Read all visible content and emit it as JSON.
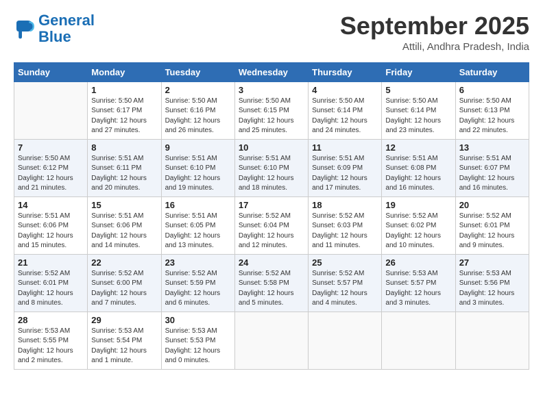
{
  "header": {
    "logo_line1": "General",
    "logo_line2": "Blue",
    "month_title": "September 2025",
    "location": "Attili, Andhra Pradesh, India"
  },
  "columns": [
    "Sunday",
    "Monday",
    "Tuesday",
    "Wednesday",
    "Thursday",
    "Friday",
    "Saturday"
  ],
  "weeks": [
    [
      {
        "day": "",
        "info": ""
      },
      {
        "day": "1",
        "info": "Sunrise: 5:50 AM\nSunset: 6:17 PM\nDaylight: 12 hours\nand 27 minutes."
      },
      {
        "day": "2",
        "info": "Sunrise: 5:50 AM\nSunset: 6:16 PM\nDaylight: 12 hours\nand 26 minutes."
      },
      {
        "day": "3",
        "info": "Sunrise: 5:50 AM\nSunset: 6:15 PM\nDaylight: 12 hours\nand 25 minutes."
      },
      {
        "day": "4",
        "info": "Sunrise: 5:50 AM\nSunset: 6:14 PM\nDaylight: 12 hours\nand 24 minutes."
      },
      {
        "day": "5",
        "info": "Sunrise: 5:50 AM\nSunset: 6:14 PM\nDaylight: 12 hours\nand 23 minutes."
      },
      {
        "day": "6",
        "info": "Sunrise: 5:50 AM\nSunset: 6:13 PM\nDaylight: 12 hours\nand 22 minutes."
      }
    ],
    [
      {
        "day": "7",
        "info": "Sunrise: 5:50 AM\nSunset: 6:12 PM\nDaylight: 12 hours\nand 21 minutes."
      },
      {
        "day": "8",
        "info": "Sunrise: 5:51 AM\nSunset: 6:11 PM\nDaylight: 12 hours\nand 20 minutes."
      },
      {
        "day": "9",
        "info": "Sunrise: 5:51 AM\nSunset: 6:10 PM\nDaylight: 12 hours\nand 19 minutes."
      },
      {
        "day": "10",
        "info": "Sunrise: 5:51 AM\nSunset: 6:10 PM\nDaylight: 12 hours\nand 18 minutes."
      },
      {
        "day": "11",
        "info": "Sunrise: 5:51 AM\nSunset: 6:09 PM\nDaylight: 12 hours\nand 17 minutes."
      },
      {
        "day": "12",
        "info": "Sunrise: 5:51 AM\nSunset: 6:08 PM\nDaylight: 12 hours\nand 16 minutes."
      },
      {
        "day": "13",
        "info": "Sunrise: 5:51 AM\nSunset: 6:07 PM\nDaylight: 12 hours\nand 16 minutes."
      }
    ],
    [
      {
        "day": "14",
        "info": "Sunrise: 5:51 AM\nSunset: 6:06 PM\nDaylight: 12 hours\nand 15 minutes."
      },
      {
        "day": "15",
        "info": "Sunrise: 5:51 AM\nSunset: 6:06 PM\nDaylight: 12 hours\nand 14 minutes."
      },
      {
        "day": "16",
        "info": "Sunrise: 5:51 AM\nSunset: 6:05 PM\nDaylight: 12 hours\nand 13 minutes."
      },
      {
        "day": "17",
        "info": "Sunrise: 5:52 AM\nSunset: 6:04 PM\nDaylight: 12 hours\nand 12 minutes."
      },
      {
        "day": "18",
        "info": "Sunrise: 5:52 AM\nSunset: 6:03 PM\nDaylight: 12 hours\nand 11 minutes."
      },
      {
        "day": "19",
        "info": "Sunrise: 5:52 AM\nSunset: 6:02 PM\nDaylight: 12 hours\nand 10 minutes."
      },
      {
        "day": "20",
        "info": "Sunrise: 5:52 AM\nSunset: 6:01 PM\nDaylight: 12 hours\nand 9 minutes."
      }
    ],
    [
      {
        "day": "21",
        "info": "Sunrise: 5:52 AM\nSunset: 6:01 PM\nDaylight: 12 hours\nand 8 minutes."
      },
      {
        "day": "22",
        "info": "Sunrise: 5:52 AM\nSunset: 6:00 PM\nDaylight: 12 hours\nand 7 minutes."
      },
      {
        "day": "23",
        "info": "Sunrise: 5:52 AM\nSunset: 5:59 PM\nDaylight: 12 hours\nand 6 minutes."
      },
      {
        "day": "24",
        "info": "Sunrise: 5:52 AM\nSunset: 5:58 PM\nDaylight: 12 hours\nand 5 minutes."
      },
      {
        "day": "25",
        "info": "Sunrise: 5:52 AM\nSunset: 5:57 PM\nDaylight: 12 hours\nand 4 minutes."
      },
      {
        "day": "26",
        "info": "Sunrise: 5:53 AM\nSunset: 5:57 PM\nDaylight: 12 hours\nand 3 minutes."
      },
      {
        "day": "27",
        "info": "Sunrise: 5:53 AM\nSunset: 5:56 PM\nDaylight: 12 hours\nand 3 minutes."
      }
    ],
    [
      {
        "day": "28",
        "info": "Sunrise: 5:53 AM\nSunset: 5:55 PM\nDaylight: 12 hours\nand 2 minutes."
      },
      {
        "day": "29",
        "info": "Sunrise: 5:53 AM\nSunset: 5:54 PM\nDaylight: 12 hours\nand 1 minute."
      },
      {
        "day": "30",
        "info": "Sunrise: 5:53 AM\nSunset: 5:53 PM\nDaylight: 12 hours\nand 0 minutes."
      },
      {
        "day": "",
        "info": ""
      },
      {
        "day": "",
        "info": ""
      },
      {
        "day": "",
        "info": ""
      },
      {
        "day": "",
        "info": ""
      }
    ]
  ]
}
